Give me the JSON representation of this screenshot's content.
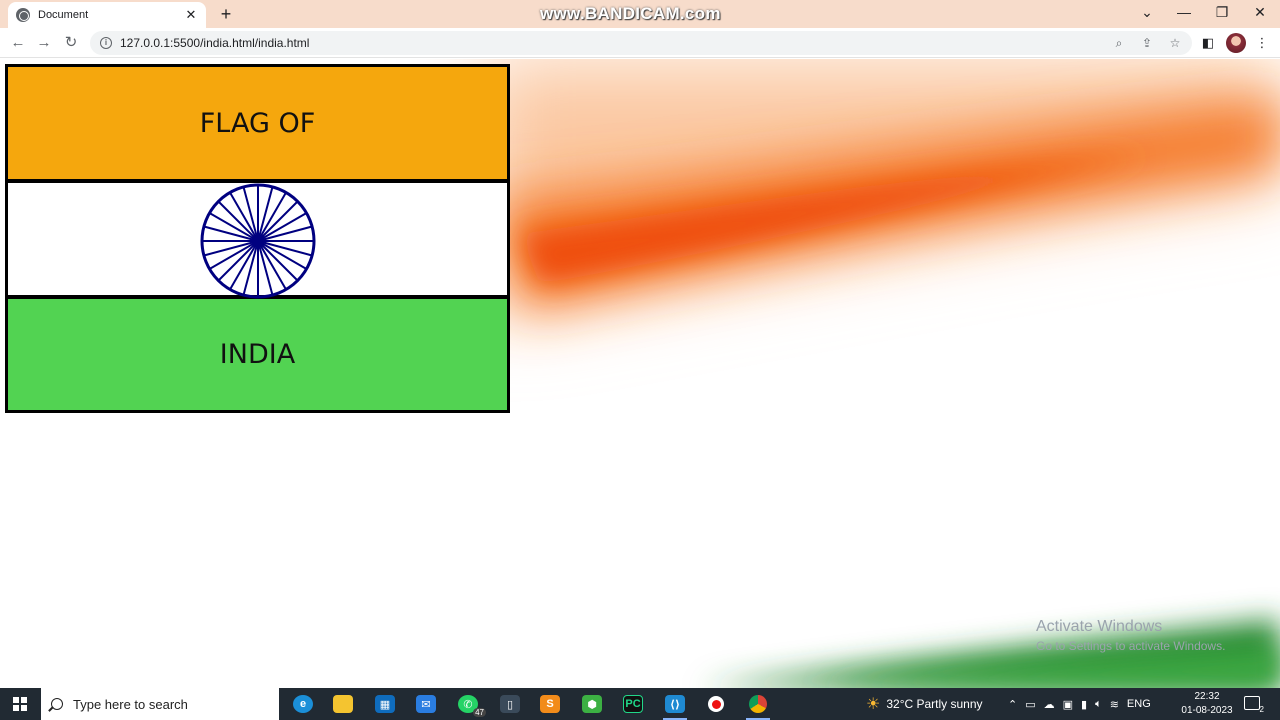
{
  "browser": {
    "tab_title": "Document",
    "tab_close": "✕",
    "new_tab": "+",
    "watermark": "www.BANDICAM.com",
    "url": "127.0.0.1:5500/india.html/india.html"
  },
  "page": {
    "flag_top_text": "FLAG OF",
    "flag_bottom_text": "INDIA",
    "chakra_spokes": 24,
    "colors": {
      "saffron": "#f5a70d",
      "white": "#ffffff",
      "green": "#52d352",
      "chakra": "#000080"
    },
    "activation_title": "Activate Windows",
    "activation_sub": "Go to Settings to activate Windows."
  },
  "taskbar": {
    "search_placeholder": "Type here to search",
    "whatsapp_badge": "47",
    "weather": "32°C  Partly sunny",
    "language": "ENG",
    "time": "22:32",
    "date": "01-08-2023",
    "notifications": "2"
  }
}
